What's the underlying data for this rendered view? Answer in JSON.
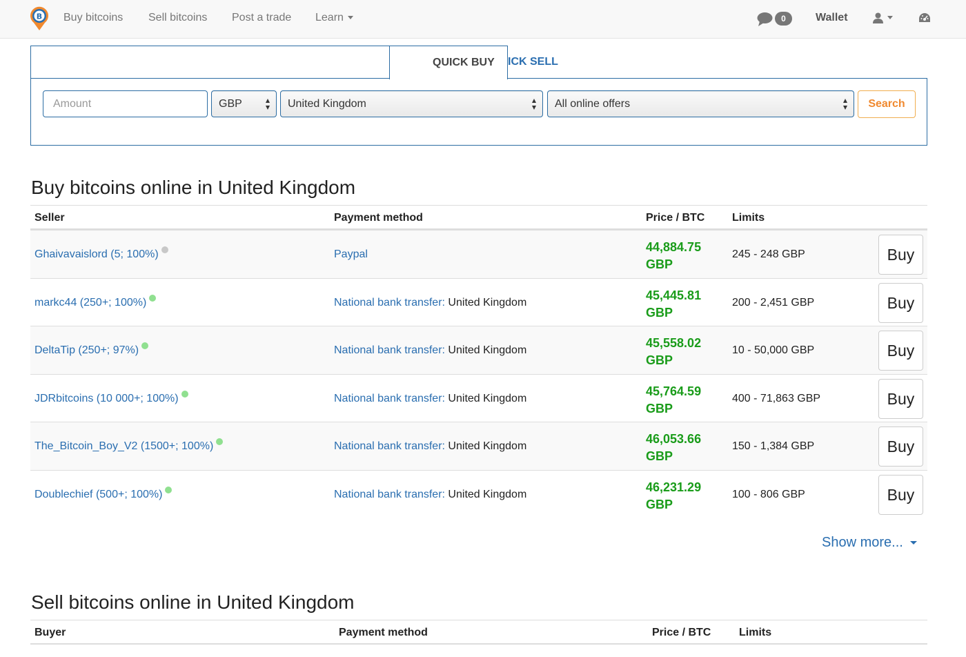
{
  "nav": {
    "links": [
      "Buy bitcoins",
      "Sell bitcoins",
      "Post a trade",
      "Learn"
    ],
    "messages_count": "0",
    "wallet": "Wallet",
    "icons": [
      "logo-pin-icon",
      "chat-bubble-icon",
      "user-icon",
      "dashboard-icon"
    ]
  },
  "quick": {
    "tab_buy": "QUICK BUY",
    "tab_sell": "QUICK SELL",
    "amount_placeholder": "Amount",
    "currency": "GBP",
    "country": "United Kingdom",
    "offer_type": "All online offers",
    "search_label": "Search"
  },
  "buy_section": {
    "title": "Buy bitcoins online in United Kingdom",
    "columns": [
      "Seller",
      "Payment method",
      "Price / BTC",
      "Limits"
    ],
    "button_label": "Buy",
    "rows": [
      {
        "seller": "Ghaivavaislord (5; 100%)",
        "status": "offline",
        "method": "Paypal",
        "method_detail": "",
        "price": "44,884.75",
        "currency": "GBP",
        "limits": "245 - 248 GBP"
      },
      {
        "seller": "markc44 (250+; 100%)",
        "status": "online",
        "method": "National bank transfer:",
        "method_detail": " United Kingdom",
        "price": "45,445.81",
        "currency": "GBP",
        "limits": "200 - 2,451 GBP"
      },
      {
        "seller": "DeltaTip (250+; 97%)",
        "status": "online",
        "method": "National bank transfer:",
        "method_detail": " United Kingdom",
        "price": "45,558.02",
        "currency": "GBP",
        "limits": "10 - 50,000 GBP"
      },
      {
        "seller": "JDRbitcoins (10 000+; 100%)",
        "status": "online",
        "method": "National bank transfer:",
        "method_detail": " United Kingdom",
        "price": "45,764.59",
        "currency": "GBP",
        "limits": "400 - 71,863 GBP"
      },
      {
        "seller": "The_Bitcoin_Boy_V2 (1500+; 100%)",
        "status": "online",
        "method": "National bank transfer:",
        "method_detail": " United Kingdom",
        "price": "46,053.66",
        "currency": "GBP",
        "limits": "150 - 1,384 GBP"
      },
      {
        "seller": "Doublechief (500+; 100%)",
        "status": "online",
        "method": "National bank transfer:",
        "method_detail": " United Kingdom",
        "price": "46,231.29",
        "currency": "GBP",
        "limits": "100 - 806 GBP"
      }
    ],
    "show_more": "Show more..."
  },
  "sell_section": {
    "title": "Sell bitcoins online in United Kingdom",
    "columns": [
      "Buyer",
      "Payment method",
      "Price / BTC",
      "Limits"
    ]
  },
  "colors": {
    "link": "#2a6eb0",
    "price": "#1a9c1a",
    "online_dot": "#90e090",
    "offline_dot": "#c8c8c8",
    "accent_border": "#2b6ca3",
    "search_orange": "#f0892f"
  }
}
